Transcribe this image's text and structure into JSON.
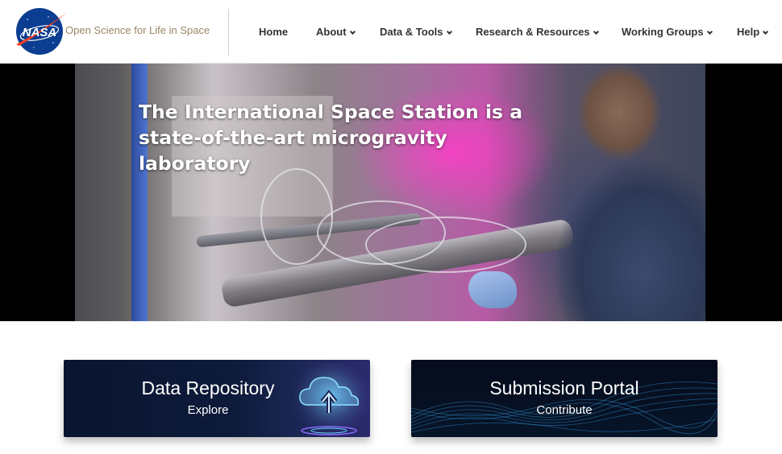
{
  "header": {
    "logo_text": "NASA",
    "site_title": "Open Science for Life in Space",
    "nav": [
      {
        "label": "Home",
        "has_dropdown": false
      },
      {
        "label": "About",
        "has_dropdown": true
      },
      {
        "label": "Data & Tools",
        "has_dropdown": true
      },
      {
        "label": "Research & Resources",
        "has_dropdown": true
      },
      {
        "label": "Working Groups",
        "has_dropdown": true
      },
      {
        "label": "Help",
        "has_dropdown": true
      }
    ]
  },
  "hero": {
    "title_line1": "The International Space Station is a",
    "title_line2": "state-of-the-art microgravity laboratory"
  },
  "cards": {
    "repository": {
      "title": "Data Repository",
      "subtitle": "Explore"
    },
    "portal": {
      "title": "Submission Portal",
      "subtitle": "Contribute"
    }
  },
  "colors": {
    "site_title": "#9b8765",
    "nasa_blue": "#0b3d91",
    "nasa_red": "#fc3d21",
    "card_bg": "#0a1530"
  },
  "icons": {
    "logo": "nasa-meatball-icon",
    "dropdown": "chevron-down-icon",
    "repository_art": "cloud-upload-icon",
    "portal_art": "data-wave-icon"
  }
}
